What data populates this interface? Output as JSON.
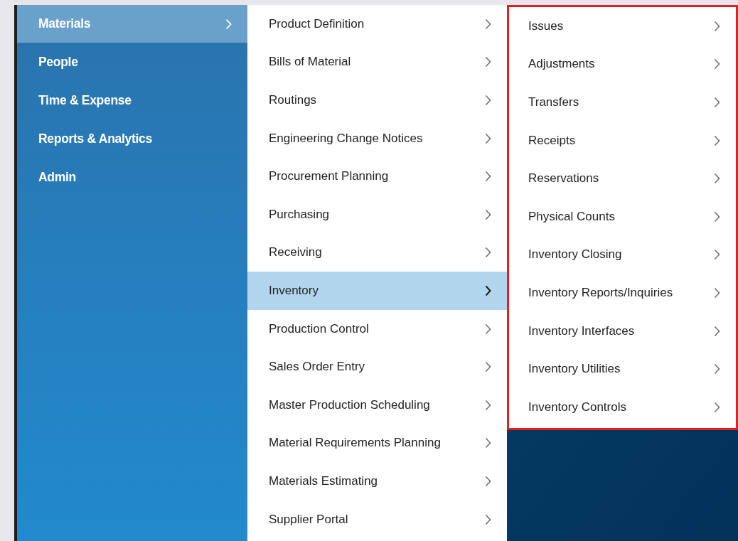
{
  "sidebar": {
    "items": [
      {
        "label": "Materials",
        "selected": true
      },
      {
        "label": "People",
        "selected": false
      },
      {
        "label": "Time & Expense",
        "selected": false
      },
      {
        "label": "Reports & Analytics",
        "selected": false
      },
      {
        "label": "Admin",
        "selected": false
      }
    ]
  },
  "menu": {
    "items": [
      {
        "label": "Product Definition",
        "selected": false
      },
      {
        "label": "Bills of Material",
        "selected": false
      },
      {
        "label": "Routings",
        "selected": false
      },
      {
        "label": "Engineering Change Notices",
        "selected": false
      },
      {
        "label": "Procurement Planning",
        "selected": false
      },
      {
        "label": "Purchasing",
        "selected": false
      },
      {
        "label": "Receiving",
        "selected": false
      },
      {
        "label": "Inventory",
        "selected": true
      },
      {
        "label": "Production Control",
        "selected": false
      },
      {
        "label": "Sales Order Entry",
        "selected": false
      },
      {
        "label": "Master Production Scheduling",
        "selected": false
      },
      {
        "label": "Material Requirements Planning",
        "selected": false
      },
      {
        "label": "Materials Estimating",
        "selected": false
      },
      {
        "label": "Supplier Portal",
        "selected": false
      }
    ]
  },
  "submenu": {
    "items": [
      {
        "label": "Issues"
      },
      {
        "label": "Adjustments"
      },
      {
        "label": "Transfers"
      },
      {
        "label": "Receipts"
      },
      {
        "label": "Reservations"
      },
      {
        "label": "Physical Counts"
      },
      {
        "label": "Inventory Closing"
      },
      {
        "label": "Inventory Reports/Inquiries"
      },
      {
        "label": "Inventory Interfaces"
      },
      {
        "label": "Inventory Utilities"
      },
      {
        "label": "Inventory Controls"
      }
    ]
  }
}
